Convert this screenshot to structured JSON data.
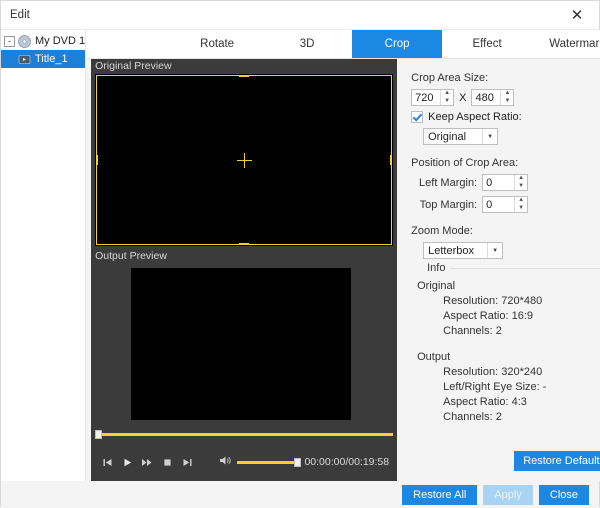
{
  "window": {
    "title": "Edit",
    "close_icon": "close-icon"
  },
  "sidebar": {
    "root": {
      "label": "My DVD 1",
      "expander": "-"
    },
    "child": {
      "label": "Title_1"
    }
  },
  "tabs": [
    {
      "label": "Rotate",
      "active": false
    },
    {
      "label": "3D",
      "active": false
    },
    {
      "label": "Crop",
      "active": true
    },
    {
      "label": "Effect",
      "active": false
    },
    {
      "label": "Watermark",
      "active": false
    }
  ],
  "preview": {
    "original_label": "Original Preview",
    "output_label": "Output Preview",
    "controls": {
      "prev_icon": "skip-previous-icon",
      "play_icon": "play-icon",
      "fast_forward_icon": "fast-forward-icon",
      "stop_icon": "stop-icon",
      "next_icon": "skip-next-icon",
      "volume_icon": "volume-icon"
    },
    "timecode": "00:00:00/00:19:58"
  },
  "settings": {
    "crop_area_size_label": "Crop Area Size:",
    "width": "720",
    "separator": "X",
    "height": "480",
    "keep_aspect_ratio_label": "Keep Aspect Ratio:",
    "keep_aspect_ratio_checked": true,
    "aspect_ratio_value": "Original",
    "position_label": "Position of Crop Area:",
    "left_margin_label": "Left Margin:",
    "left_margin_value": "0",
    "top_margin_label": "Top Margin:",
    "top_margin_value": "0",
    "zoom_mode_label": "Zoom Mode:",
    "zoom_mode_value": "Letterbox",
    "restore_defaults_label": "Restore Defaults"
  },
  "info": {
    "header": "Info",
    "original_title": "Original",
    "original_lines": [
      "Resolution: 720*480",
      "Aspect Ratio: 16:9",
      "Channels: 2"
    ],
    "output_title": "Output",
    "output_lines": [
      "Resolution: 320*240",
      "Left/Right Eye Size: -",
      "Aspect Ratio: 4:3",
      "Channels: 2"
    ]
  },
  "footer": {
    "restore_all_label": "Restore All",
    "apply_label": "Apply",
    "close_label": "Close"
  },
  "colors": {
    "accent": "#1d87e4",
    "crop_outline": "#f2d22a",
    "selection": "#1d7fd7"
  }
}
